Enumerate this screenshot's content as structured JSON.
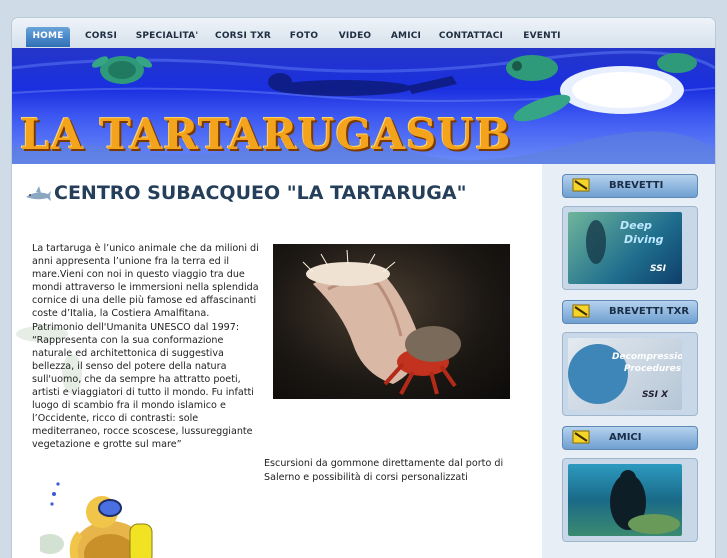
{
  "nav": {
    "items": [
      {
        "label": "HOME",
        "active": true
      },
      {
        "label": "CORSI"
      },
      {
        "label": "SPECIALITA'"
      },
      {
        "label": "CORSI TXR"
      },
      {
        "label": "FOTO"
      },
      {
        "label": "VIDEO"
      },
      {
        "label": "AMICI"
      },
      {
        "label": "CONTATTACI"
      },
      {
        "label": "EVENTI"
      }
    ]
  },
  "banner": {
    "title": "LA TARTARUGASUB"
  },
  "main": {
    "heading": "CENTRO SUBACQUEO \"LA TARTARUGA\"",
    "intro_paragraphs": [
      "La tartaruga è l’unico animale che da milioni di anni appresenta l’unione fra la terra ed il mare.Vieni con noi in questo viaggio tra due mondi attraverso le immersioni nella splendida cornice di una delle più famose ed affascinanti coste d’Italia, la Costiera Amalfitana.",
      "Patrimonio dell'Umanita UNESCO dal 1997:",
      "“Rappresenta con la sua conformazione naturale ed architettonica di suggestiva bellezza, il senso del potere della natura sull'uomo, che da sempre ha attratto poeti, artisti e viaggiatori di tutto il mondo. Fu infatti luogo di scambio fra il mondo islamico e l’Occidente, ricco di contrasti: sole mediterraneo, rocce scoscese, lussureggiante vegetazione e grotte sul mare”"
    ],
    "caption": " Escursioni da gommone direttamente dal porto di Salerno e possibilità di corsi personalizzati"
  },
  "sidebar": {
    "sections": [
      {
        "label": "BREVETTI",
        "thumb_lines": [
          "Deep",
          "Diving"
        ],
        "thumb_badge": "SSI"
      },
      {
        "label": "BREVETTI TXR",
        "thumb_lines": [
          "Decompression",
          "Procedures"
        ],
        "thumb_badge": "SSI X"
      },
      {
        "label": "AMICI"
      }
    ]
  },
  "colors": {
    "nav_active": "#2f6fb5",
    "heading": "#253f5a",
    "banner_title": "#f4a31c",
    "sidebar_bg": "#e8eef5"
  }
}
